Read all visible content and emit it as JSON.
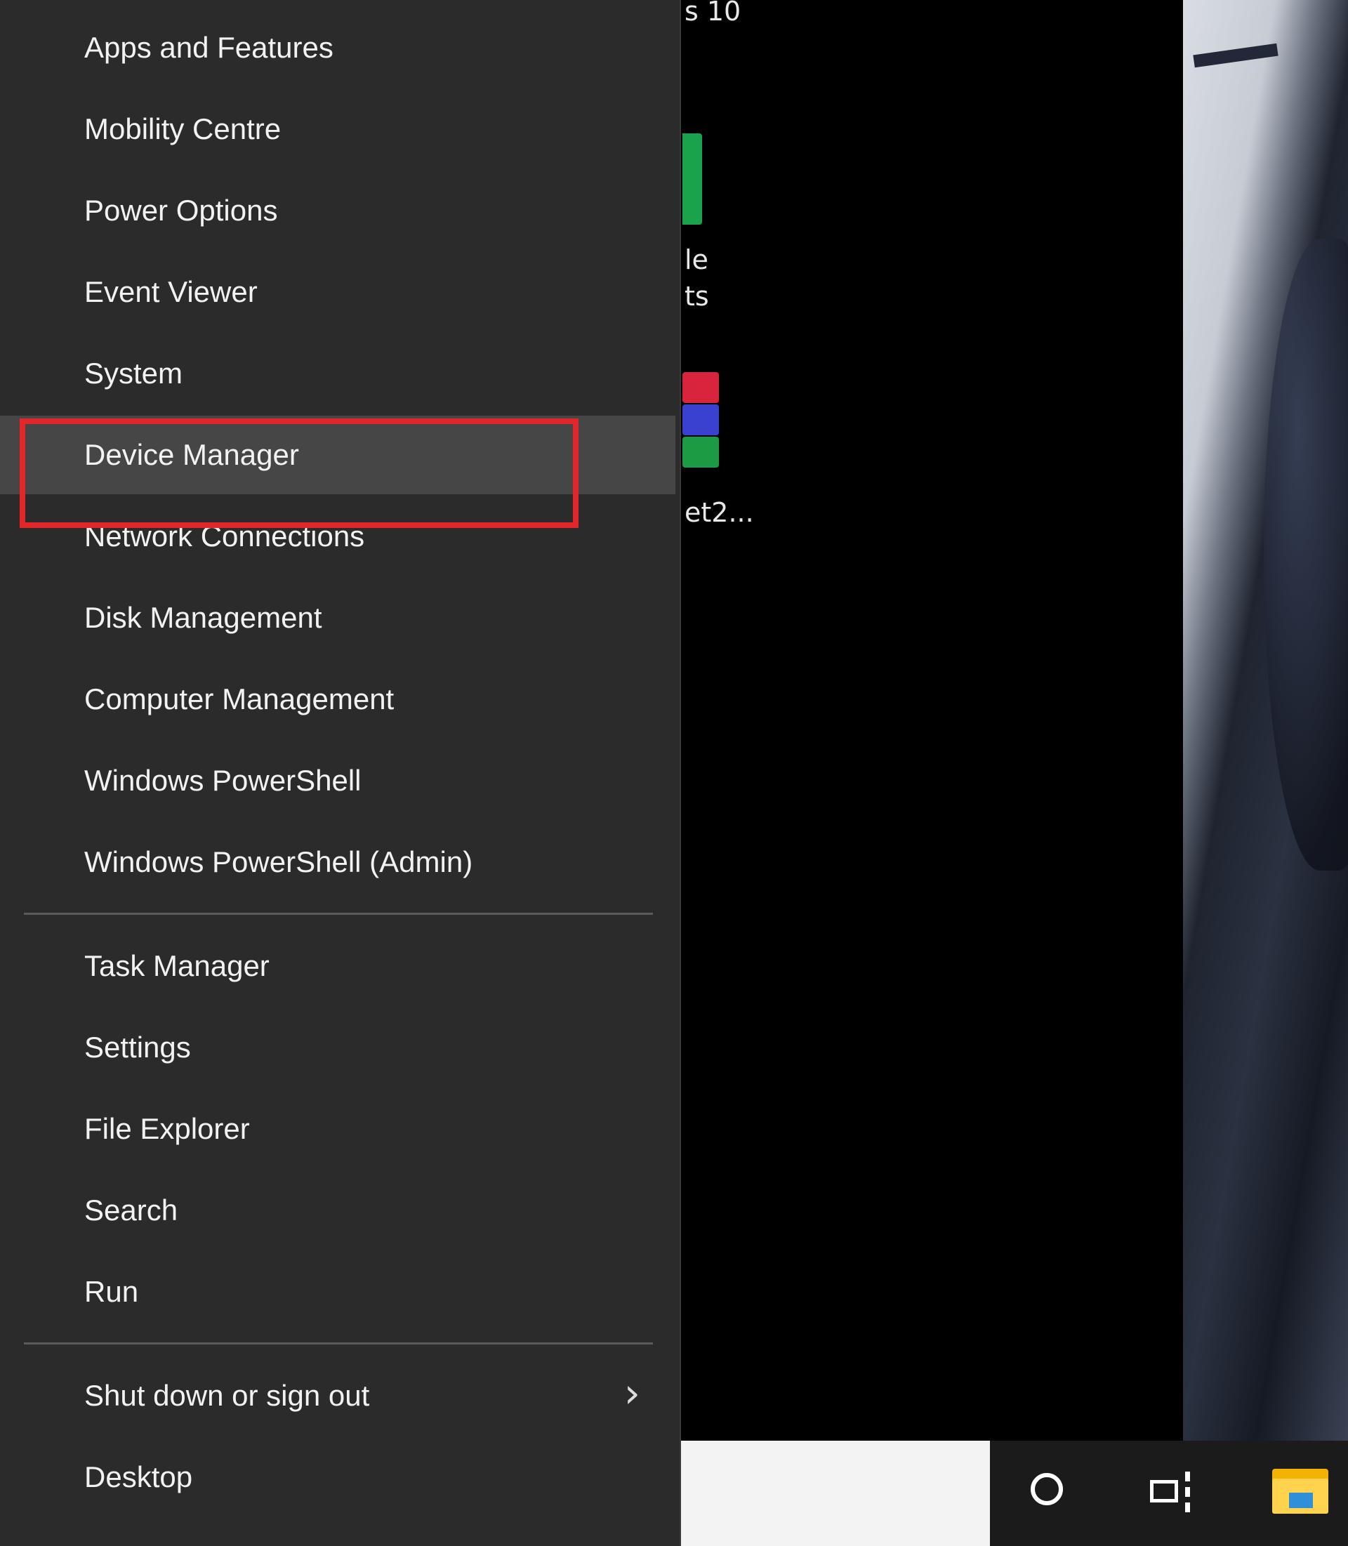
{
  "menu": {
    "items": [
      {
        "label": "Apps and Features"
      },
      {
        "label": "Mobility Centre"
      },
      {
        "label": "Power Options"
      },
      {
        "label": "Event Viewer"
      },
      {
        "label": "System"
      },
      {
        "label": "Device Manager"
      },
      {
        "label": "Network Connections"
      },
      {
        "label": "Disk Management"
      },
      {
        "label": "Computer Management"
      },
      {
        "label": "Windows PowerShell"
      },
      {
        "label": "Windows PowerShell (Admin)"
      },
      {
        "label": "Task Manager"
      },
      {
        "label": "Settings"
      },
      {
        "label": "File Explorer"
      },
      {
        "label": "Search"
      },
      {
        "label": "Run"
      },
      {
        "label": "Shut down or sign out"
      },
      {
        "label": "Desktop"
      }
    ],
    "selected": "Device Manager"
  },
  "desktop": {
    "fragment_top": "s 10",
    "fragment_icon1_line1": "le",
    "fragment_icon1_line2": "ts",
    "fragment_icon2": "et2..."
  },
  "colors": {
    "menu_bg": "#2b2b2b",
    "selected_bg": "#464646",
    "highlight_box": "#e3262a"
  }
}
